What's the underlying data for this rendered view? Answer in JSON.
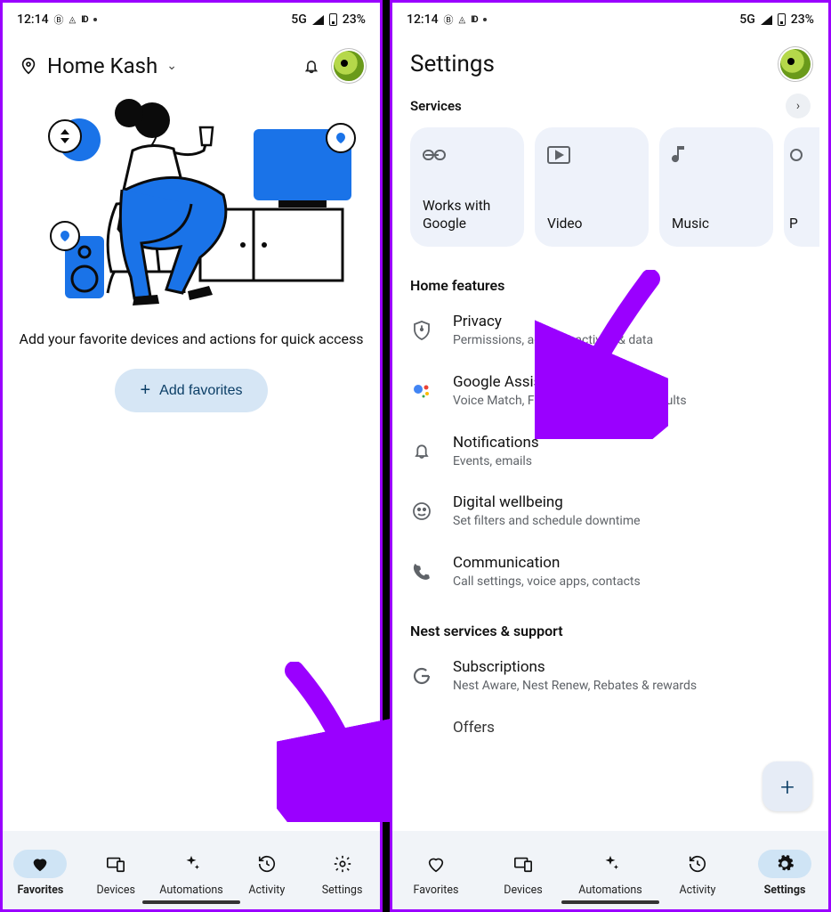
{
  "status": {
    "time": "12:14",
    "net": "5G",
    "battery": "23%"
  },
  "home": {
    "title": "Home Kash",
    "message": "Add your favorite devices and actions for quick access",
    "add_label": "Add favorites"
  },
  "nav": {
    "favorites": "Favorites",
    "devices": "Devices",
    "automations": "Automations",
    "activity": "Activity",
    "settings": "Settings"
  },
  "settings": {
    "title": "Settings",
    "services_label": "Services",
    "tiles": {
      "works": "Works with Google",
      "video": "Video",
      "music": "Music",
      "partial": "P"
    },
    "home_features": "Home features",
    "rows": {
      "privacy": {
        "title": "Privacy",
        "sub": "Permissions, account activity & data"
      },
      "assistant": {
        "title": "Google Assistant",
        "sub": "Voice Match, Face Match, personal results"
      },
      "notifications": {
        "title": "Notifications",
        "sub": "Events, emails"
      },
      "wellbeing": {
        "title": "Digital wellbeing",
        "sub": "Set filters and schedule downtime"
      },
      "communication": {
        "title": "Communication",
        "sub": "Call settings, voice apps, contacts"
      }
    },
    "nest_header": "Nest services & support",
    "subscriptions": {
      "title": "Subscriptions",
      "sub": "Nest Aware, Nest Renew, Rebates & rewards"
    },
    "offers_title": "Offers"
  }
}
